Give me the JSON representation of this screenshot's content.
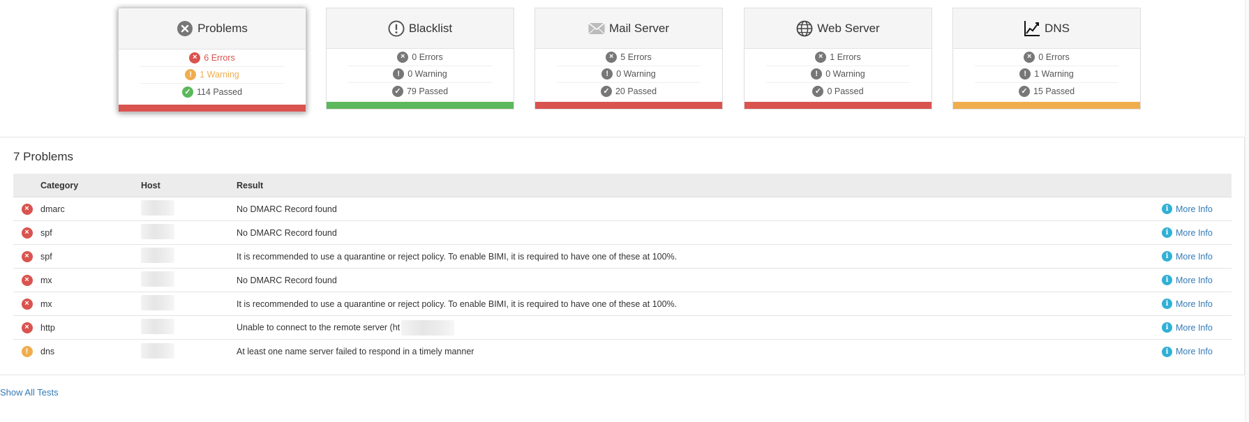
{
  "cards": [
    {
      "title": "Problems",
      "icon": "x-circle-icon",
      "errors": "6 Errors",
      "warnings": "1 Warning",
      "passed": "114 Passed",
      "bar_color": "#d9534f"
    },
    {
      "title": "Blacklist",
      "icon": "exclamation-circle-icon",
      "errors": "0 Errors",
      "warnings": "0 Warning",
      "passed": "79 Passed",
      "bar_color": "#5cb85c"
    },
    {
      "title": "Mail Server",
      "icon": "envelope-icon",
      "errors": "5 Errors",
      "warnings": "0 Warning",
      "passed": "20 Passed",
      "bar_color": "#d9534f"
    },
    {
      "title": "Web Server",
      "icon": "globe-icon",
      "errors": "1 Errors",
      "warnings": "0 Warning",
      "passed": "0 Passed",
      "bar_color": "#d9534f"
    },
    {
      "title": "DNS",
      "icon": "chart-line-icon",
      "errors": "0 Errors",
      "warnings": "1 Warning",
      "passed": "15 Passed",
      "bar_color": "#f0ad4e"
    }
  ],
  "problems": {
    "title": "7 Problems",
    "columns": {
      "category": "Category",
      "host": "Host",
      "result": "Result"
    },
    "rows": [
      {
        "status": "error",
        "category": "dmarc",
        "result": "No DMARC Record found",
        "more": "More Info"
      },
      {
        "status": "error",
        "category": "spf",
        "result": "No DMARC Record found",
        "more": "More Info"
      },
      {
        "status": "error",
        "category": "spf",
        "result": "It is recommended to use a quarantine or reject policy. To enable BIMI, it is required to have one of these at 100%.",
        "more": "More Info"
      },
      {
        "status": "error",
        "category": "mx",
        "result": "No DMARC Record found",
        "more": "More Info"
      },
      {
        "status": "error",
        "category": "mx",
        "result": "It is recommended to use a quarantine or reject policy. To enable BIMI, it is required to have one of these at 100%.",
        "more": "More Info"
      },
      {
        "status": "error",
        "category": "http",
        "result": "Unable to connect to the remote server (ht",
        "more": "More Info"
      },
      {
        "status": "warning",
        "category": "dns",
        "result": "At least one name server failed to respond in a timely manner",
        "more": "More Info"
      }
    ]
  },
  "show_all": "Show All Tests"
}
